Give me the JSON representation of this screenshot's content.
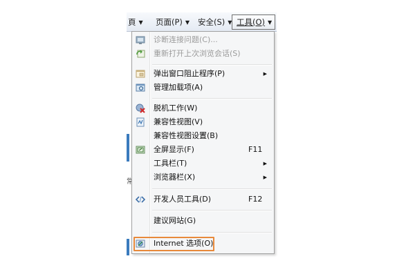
{
  "command_bar": {
    "partial_left": "頁",
    "page": "页面(P)",
    "safety": "安全(S)",
    "tools": "工具(O)",
    "caret": "▼"
  },
  "background": {
    "fragment": "常"
  },
  "menu": {
    "items": [
      {
        "label": "诊断连接问题(C)...",
        "shortcut": "",
        "submenu": false,
        "disabled": true,
        "icon": "diagnose-connection-icon"
      },
      {
        "label": "重新打开上次浏览会话(S)",
        "shortcut": "",
        "submenu": false,
        "disabled": true,
        "icon": "reopen-session-icon"
      },
      {
        "label": "弹出窗口阻止程序(P)",
        "shortcut": "",
        "submenu": true,
        "disabled": false,
        "icon": "popup-blocker-icon"
      },
      {
        "label": "管理加载项(A)",
        "shortcut": "",
        "submenu": false,
        "disabled": false,
        "icon": "manage-addons-icon"
      },
      {
        "label": "脱机工作(W)",
        "shortcut": "",
        "submenu": false,
        "disabled": false,
        "icon": "work-offline-icon"
      },
      {
        "label": "兼容性视图(V)",
        "shortcut": "",
        "submenu": false,
        "disabled": false,
        "icon": "compatibility-view-icon"
      },
      {
        "label": "兼容性视图设置(B)",
        "shortcut": "",
        "submenu": false,
        "disabled": false,
        "icon": ""
      },
      {
        "label": "全屏显示(F)",
        "shortcut": "F11",
        "submenu": false,
        "disabled": false,
        "icon": "full-screen-icon"
      },
      {
        "label": "工具栏(T)",
        "shortcut": "",
        "submenu": true,
        "disabled": false,
        "icon": ""
      },
      {
        "label": "浏览器栏(X)",
        "shortcut": "",
        "submenu": true,
        "disabled": false,
        "icon": ""
      },
      {
        "label": "开发人员工具(D)",
        "shortcut": "F12",
        "submenu": false,
        "disabled": false,
        "icon": "developer-tools-icon"
      },
      {
        "label": "建议网站(G)",
        "shortcut": "",
        "submenu": false,
        "disabled": false,
        "icon": ""
      },
      {
        "label": "Internet 选项(O)",
        "shortcut": "",
        "submenu": false,
        "disabled": false,
        "icon": "internet-options-icon",
        "highlighted": true
      }
    ],
    "submenu_arrow": "▶"
  },
  "colors": {
    "highlight_border": "#e8893a",
    "menu_bg": "#f5f6f7",
    "disabled_text": "#9a9a9a"
  }
}
